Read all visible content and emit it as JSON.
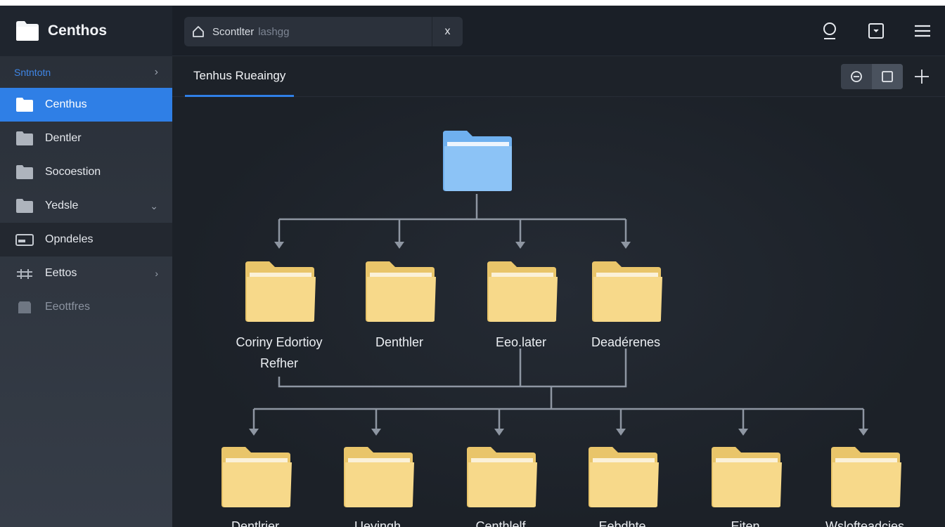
{
  "app": {
    "title": "Centhos"
  },
  "search": {
    "label": "Scontlter",
    "placeholder": "lashgg",
    "clear_glyph": "x"
  },
  "top_icons": [
    "user-icon",
    "checkbox-dropdown-icon",
    "menu-icon"
  ],
  "sidebar": {
    "header": "Sntntotn",
    "items": [
      {
        "label": "Centhus",
        "icon": "folder-icon",
        "active": true
      },
      {
        "label": "Dentler",
        "icon": "folder-icon"
      },
      {
        "label": "Socoestion",
        "icon": "folder-icon"
      },
      {
        "label": "Yedsle",
        "icon": "folder-icon",
        "trail": "chevron-down"
      },
      {
        "label": "Opndeles",
        "icon": "drive-icon",
        "section": true
      },
      {
        "label": "Eettos",
        "icon": "tools-icon",
        "trail": "chevron-right"
      },
      {
        "label": "Eeottfres",
        "icon": "archive-icon",
        "dim": true
      }
    ]
  },
  "main": {
    "tab": "Tenhus Rueaingy",
    "view_icons": [
      "preview-icon",
      "square-icon"
    ],
    "add_icon": "plus-icon"
  },
  "tree": {
    "root": {
      "label": ""
    },
    "level1": [
      {
        "label": "Coriny Edortioy Refher"
      },
      {
        "label": "Denthler"
      },
      {
        "label": "Eeo.later"
      },
      {
        "label": "Deadérenes"
      }
    ],
    "level2": [
      {
        "label": "Dentlrier"
      },
      {
        "label": "Ueyingh"
      },
      {
        "label": "Centhlelf"
      },
      {
        "label": "Eebdhte"
      },
      {
        "label": "Eiten"
      },
      {
        "label": "Wslofteadcies"
      }
    ]
  },
  "colors": {
    "accent": "#2f7fe6",
    "folder_yellow": "#f7d98a",
    "folder_blue": "#8cc3f6",
    "connector": "#8e96a2"
  }
}
